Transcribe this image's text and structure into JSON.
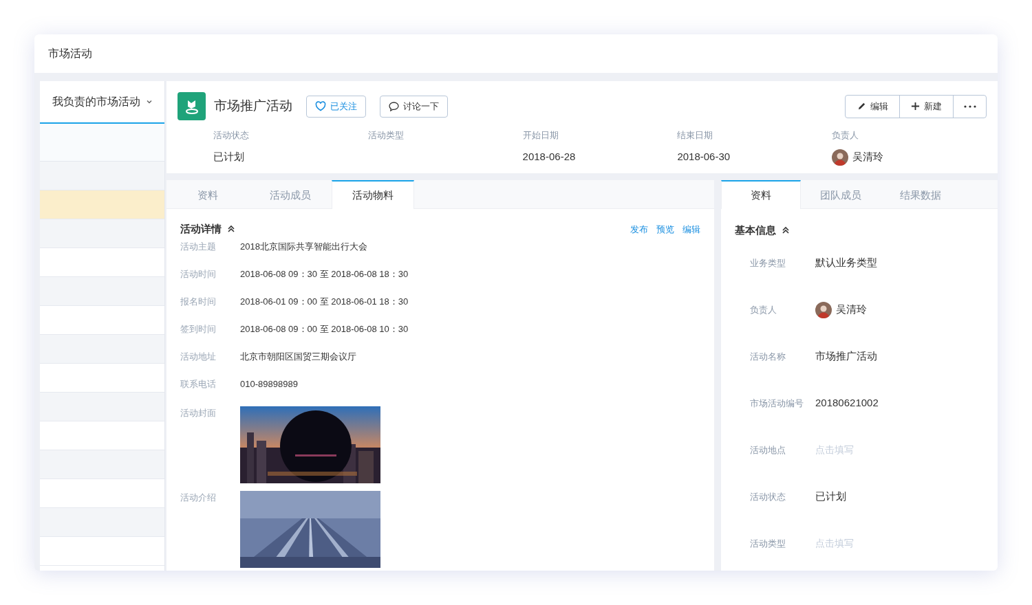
{
  "page": {
    "title": "市场活动"
  },
  "sidebar": {
    "filter": "我负责的市场活动",
    "rows": [
      {
        "selected": false
      },
      {
        "selected": true
      },
      {
        "selected": false
      },
      {
        "selected": false
      },
      {
        "selected": false
      },
      {
        "selected": false
      },
      {
        "selected": false
      },
      {
        "selected": false
      },
      {
        "selected": false
      },
      {
        "selected": false
      },
      {
        "selected": false
      },
      {
        "selected": false
      },
      {
        "selected": false
      },
      {
        "selected": false
      }
    ]
  },
  "record": {
    "name": "市场推广活动",
    "follow_label": "已关注",
    "discuss_label": "讨论一下",
    "actions": [
      {
        "kind": "edit",
        "label": "编辑"
      },
      {
        "kind": "new",
        "label": "新建"
      },
      {
        "kind": "more"
      }
    ],
    "summary": [
      {
        "label": "活动状态",
        "value": "已计划"
      },
      {
        "label": "活动类型"
      },
      {
        "label": "开始日期",
        "value": "2018-06-28"
      },
      {
        "label": "结束日期",
        "value": "2018-06-30"
      },
      {
        "label": "负责人",
        "value": "吴清玲",
        "kind": "person"
      }
    ]
  },
  "left_panel": {
    "tabs": [
      {
        "label": "资料",
        "selected": false
      },
      {
        "label": "活动成员",
        "selected": false
      },
      {
        "label": "活动物料",
        "selected": true
      }
    ],
    "section": {
      "title": "活动详情",
      "expanded": true,
      "links": [
        "发布",
        "预览",
        "编辑"
      ],
      "fields": [
        {
          "label": "活动主题",
          "value": "2018北京国际共享智能出行大会"
        },
        {
          "label": "活动时间",
          "value": "2018-06-08 09：30 至 2018-06-08 18：30"
        },
        {
          "label": "报名时间",
          "value": "2018-06-01 09：00 至 2018-06-01 18：30"
        },
        {
          "label": "签到时间",
          "value": "2018-06-08 09：00 至 2018-06-08 10：30"
        },
        {
          "label": "活动地址",
          "value": "北京市朝阳区国贸三期会议厅"
        },
        {
          "label": "联系电话",
          "value": "010-89898989"
        },
        {
          "label": "活动封面",
          "kind": "picture"
        },
        {
          "label": "活动介绍",
          "kind": "picture"
        }
      ]
    }
  },
  "right_panel": {
    "tabs": [
      {
        "label": "资料",
        "selected": true
      },
      {
        "label": "团队成员",
        "selected": false
      },
      {
        "label": "结果数据",
        "selected": false
      }
    ],
    "section": {
      "title": "基本信息",
      "expanded": true,
      "fields": [
        {
          "label": "业务类型",
          "value": "默认业务类型"
        },
        {
          "label": "负责人",
          "value": "吴清玲",
          "kind": "person"
        },
        {
          "label": "活动名称",
          "value": "市场推广活动"
        },
        {
          "label": "市场活动编号",
          "value": "20180621002"
        },
        {
          "label": "活动地点",
          "placeholder": "点击填写"
        },
        {
          "label": "活动状态",
          "value": "已计划"
        },
        {
          "label": "活动类型",
          "placeholder": "点击填写"
        }
      ]
    }
  }
}
